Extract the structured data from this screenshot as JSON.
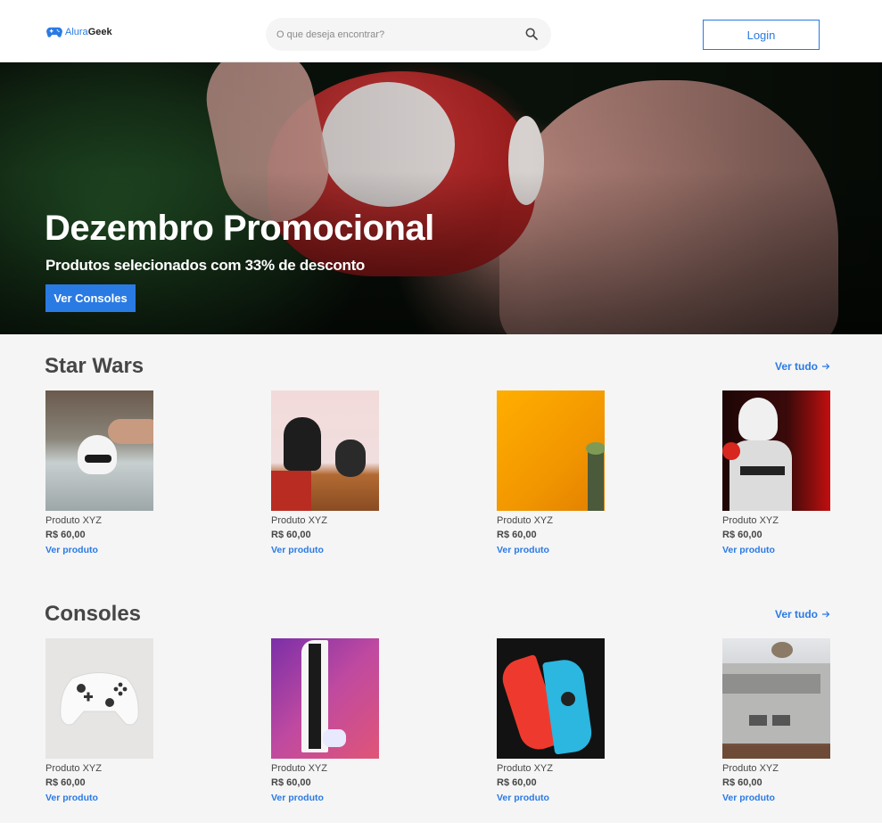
{
  "header": {
    "logo_part1": "Alura",
    "logo_part2": "Geek",
    "search_placeholder": "O que deseja encontrar?",
    "login_label": "Login"
  },
  "hero": {
    "title": "Dezembro Promocional",
    "subtitle": "Produtos selecionados com 33% de desconto",
    "cta_label": "Ver Consoles"
  },
  "sections": [
    {
      "title": "Star Wars",
      "see_all": "Ver tudo",
      "products": [
        {
          "name": "Produto XYZ",
          "price": "R$ 60,00",
          "link": "Ver produto"
        },
        {
          "name": "Produto XYZ",
          "price": "R$ 60,00",
          "link": "Ver produto"
        },
        {
          "name": "Produto XYZ",
          "price": "R$ 60,00",
          "link": "Ver produto"
        },
        {
          "name": "Produto XYZ",
          "price": "R$ 60,00",
          "link": "Ver produto"
        }
      ]
    },
    {
      "title": "Consoles",
      "see_all": "Ver tudo",
      "products": [
        {
          "name": "Produto XYZ",
          "price": "R$ 60,00",
          "link": "Ver produto"
        },
        {
          "name": "Produto XYZ",
          "price": "R$ 60,00",
          "link": "Ver produto"
        },
        {
          "name": "Produto XYZ",
          "price": "R$ 60,00",
          "link": "Ver produto"
        },
        {
          "name": "Produto XYZ",
          "price": "R$ 60,00",
          "link": "Ver produto"
        }
      ]
    }
  ],
  "colors": {
    "accent": "#2A7AE4",
    "text": "#464646",
    "background": "#F5F5F5"
  }
}
